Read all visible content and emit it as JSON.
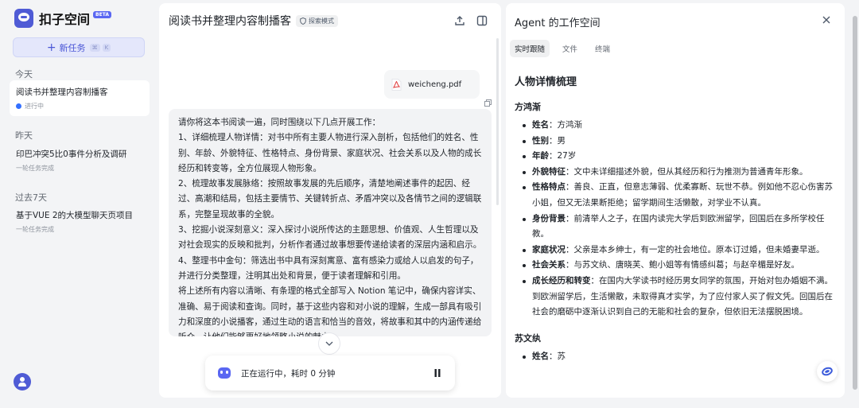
{
  "sidebar": {
    "brand": "扣子空间",
    "beta": "BETA",
    "new_task": "新任务",
    "new_task_keys": [
      "⌘",
      "K"
    ],
    "sections": [
      {
        "title": "今天",
        "tasks": [
          {
            "title": "阅读书并整理内容制播客",
            "status": "进行中"
          }
        ]
      },
      {
        "title": "昨天",
        "tasks": [
          {
            "title": "印巴冲突5比0事件分析及调研",
            "status": "一轮任务完成"
          }
        ]
      },
      {
        "title": "过去7天",
        "tasks": [
          {
            "title": "基于VUE 2的大模型聊天页项目",
            "status": "一轮任务完成"
          }
        ]
      }
    ]
  },
  "chat": {
    "title": "阅读书并整理内容制播客",
    "mode_badge": "探索模式",
    "attachment": "weicheng.pdf",
    "message": [
      "请你将这本书阅读一遍，同时围绕以下几点开展工作：",
      "1、详细梳理人物详情：对书中所有主要人物进行深入剖析，包括他们的姓名、性别、年龄、外貌特征、性格特点、身份背景、家庭状况、社会关系以及人物的成长经历和转变等，全方位展现人物形象。",
      "2、梳理故事发展脉络：按照故事发展的先后顺序，清楚地阐述事件的起因、经过、高潮和结局，包括主要情节、关键转折点、矛盾冲突以及各情节之间的逻辑联系，完整呈现故事的全貌。",
      "3、挖掘小说深刻意义：深入探讨小说所传达的主题思想、价值观、人生哲理以及对社会现实的反映和批判，分析作者通过故事想要传递给读者的深层内涵和启示。",
      "4、整理书中金句：筛选出书中具有深刻寓意、富有感染力或给人以启发的句子，并进行分类整理，注明其出处和背景，便于读者理解和引用。",
      "将上述所有内容以清晰、有条理的格式全部写入 Notion 笔记中，确保内容详实、准确、易于阅读和查询。同时，基于这些内容和对小说的理解，生成一部具有吸引力和深度的小说播客，通过生动的语言和恰当的音效，将故事和其中的内涵传递给听众，让他们能够更好地领略小说的魅力。"
    ],
    "running_status": "正在运行中，耗时 0 分钟"
  },
  "agent": {
    "title": "Agent 的工作空间",
    "tabs": [
      "实时跟随",
      "文件",
      "终端"
    ],
    "active_tab": "实时跟随",
    "heading": "人物详情梳理",
    "characters": [
      {
        "name": "方鸿渐",
        "fields": [
          {
            "label": "姓名",
            "value": "：方鸿渐"
          },
          {
            "label": "性别",
            "value": "：男"
          },
          {
            "label": "年龄",
            "value": "：27岁"
          },
          {
            "label": "外貌特征",
            "value": "：文中未详细描述外貌，但从其经历和行为推测为普通青年形象。"
          },
          {
            "label": "性格特点",
            "value": "：善良、正直，但意志薄弱、优柔寡断、玩世不恭。例如他不忍心伤害苏小姐，但又无法果断拒绝；留学期间生活懒散，对学业不认真。"
          },
          {
            "label": "身份背景",
            "value": "：前清举人之子，在国内读完大学后到欧洲留学，回国后在多所学校任教。"
          },
          {
            "label": "家庭状况",
            "value": "：父亲是本乡绅士，有一定的社会地位。原本订过婚，但未婚妻早逝。"
          },
          {
            "label": "社会关系",
            "value": "：与苏文纨、唐晓芙、鲍小姐等有情感纠葛；与赵辛楣是好友。"
          },
          {
            "label": "成长经历和转变",
            "value": "：在国内大学读书时经历男女同学的氛围，开始对包办婚姻不满。到欧洲留学后，生活懒散，未取得真才实学，为了应付家人买了假文凭。回国后在社会的磨砺中逐渐认识到自己的无能和社会的复杂，但依旧无法摆脱困境。"
          }
        ]
      },
      {
        "name": "苏文纨",
        "fields": [
          {
            "label": "姓名",
            "value": "：苏"
          }
        ]
      }
    ]
  },
  "colors": {
    "accent": "#4f5bd5",
    "panel_bg": "#ffffff",
    "page_bg": "#f3f4f6",
    "status_dot": "#3370ff"
  }
}
